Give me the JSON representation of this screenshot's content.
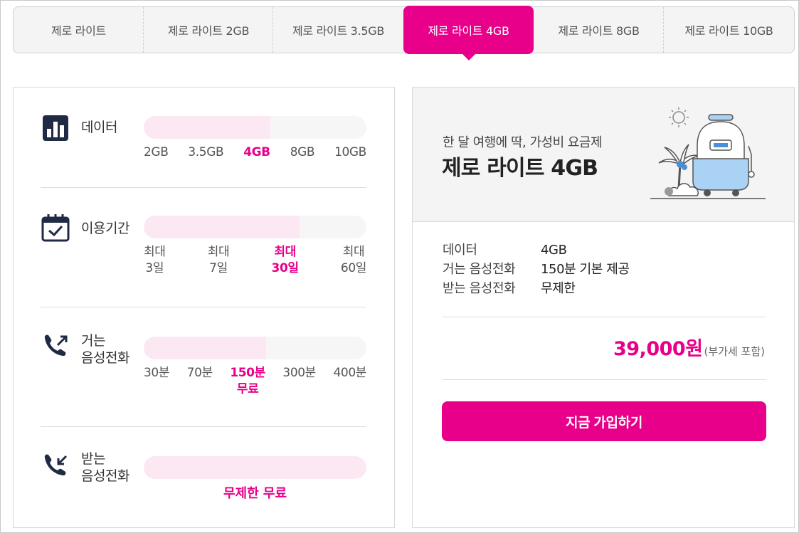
{
  "tabs": [
    {
      "label": "제로 라이트"
    },
    {
      "label": "제로 라이트 2GB"
    },
    {
      "label": "제로 라이트 3.5GB"
    },
    {
      "label": "제로 라이트 4GB",
      "active": true
    },
    {
      "label": "제로 라이트 8GB"
    },
    {
      "label": "제로 라이트 10GB"
    }
  ],
  "rows": {
    "data": {
      "label": "데이터",
      "fill": 0.57,
      "ticks": [
        "2GB",
        "3.5GB",
        "4GB",
        "8GB",
        "10GB"
      ],
      "selected_index": 2
    },
    "period": {
      "label": "이용기간",
      "fill": 0.7,
      "ticks": [
        [
          "최대",
          "3일"
        ],
        [
          "최대",
          "7일"
        ],
        [
          "최대",
          "30일"
        ],
        [
          "최대",
          "60일"
        ]
      ],
      "selected_index": 2
    },
    "outgoing": {
      "label_1": "거는",
      "label_2": "음성전화",
      "fill": 0.55,
      "ticks": [
        [
          "30분"
        ],
        [
          "70분"
        ],
        [
          "150분",
          "무료"
        ],
        [
          "300분"
        ],
        [
          "400분"
        ]
      ],
      "selected_index": 2
    },
    "incoming": {
      "label_1": "받는",
      "label_2": "음성전화",
      "fill": 1.0,
      "value": "무제한 무료"
    }
  },
  "plan": {
    "subtitle": "한 달 여행에 딱, 가성비 요금제",
    "title": "제로 라이트 4GB",
    "specs": [
      {
        "key": "데이터",
        "value": "4GB"
      },
      {
        "key": "거는 음성전화",
        "value": "150분 기본 제공"
      },
      {
        "key": "받는 음성전화",
        "value": "무제한"
      }
    ],
    "price": "39,000원",
    "vat_note": "(부가세 포함)",
    "cta_label": "지금 가입하기"
  },
  "colors": {
    "accent": "#e8008a",
    "track": "#f6f6f6",
    "fill": "#fce8f3",
    "icon": "#1f2a44"
  }
}
